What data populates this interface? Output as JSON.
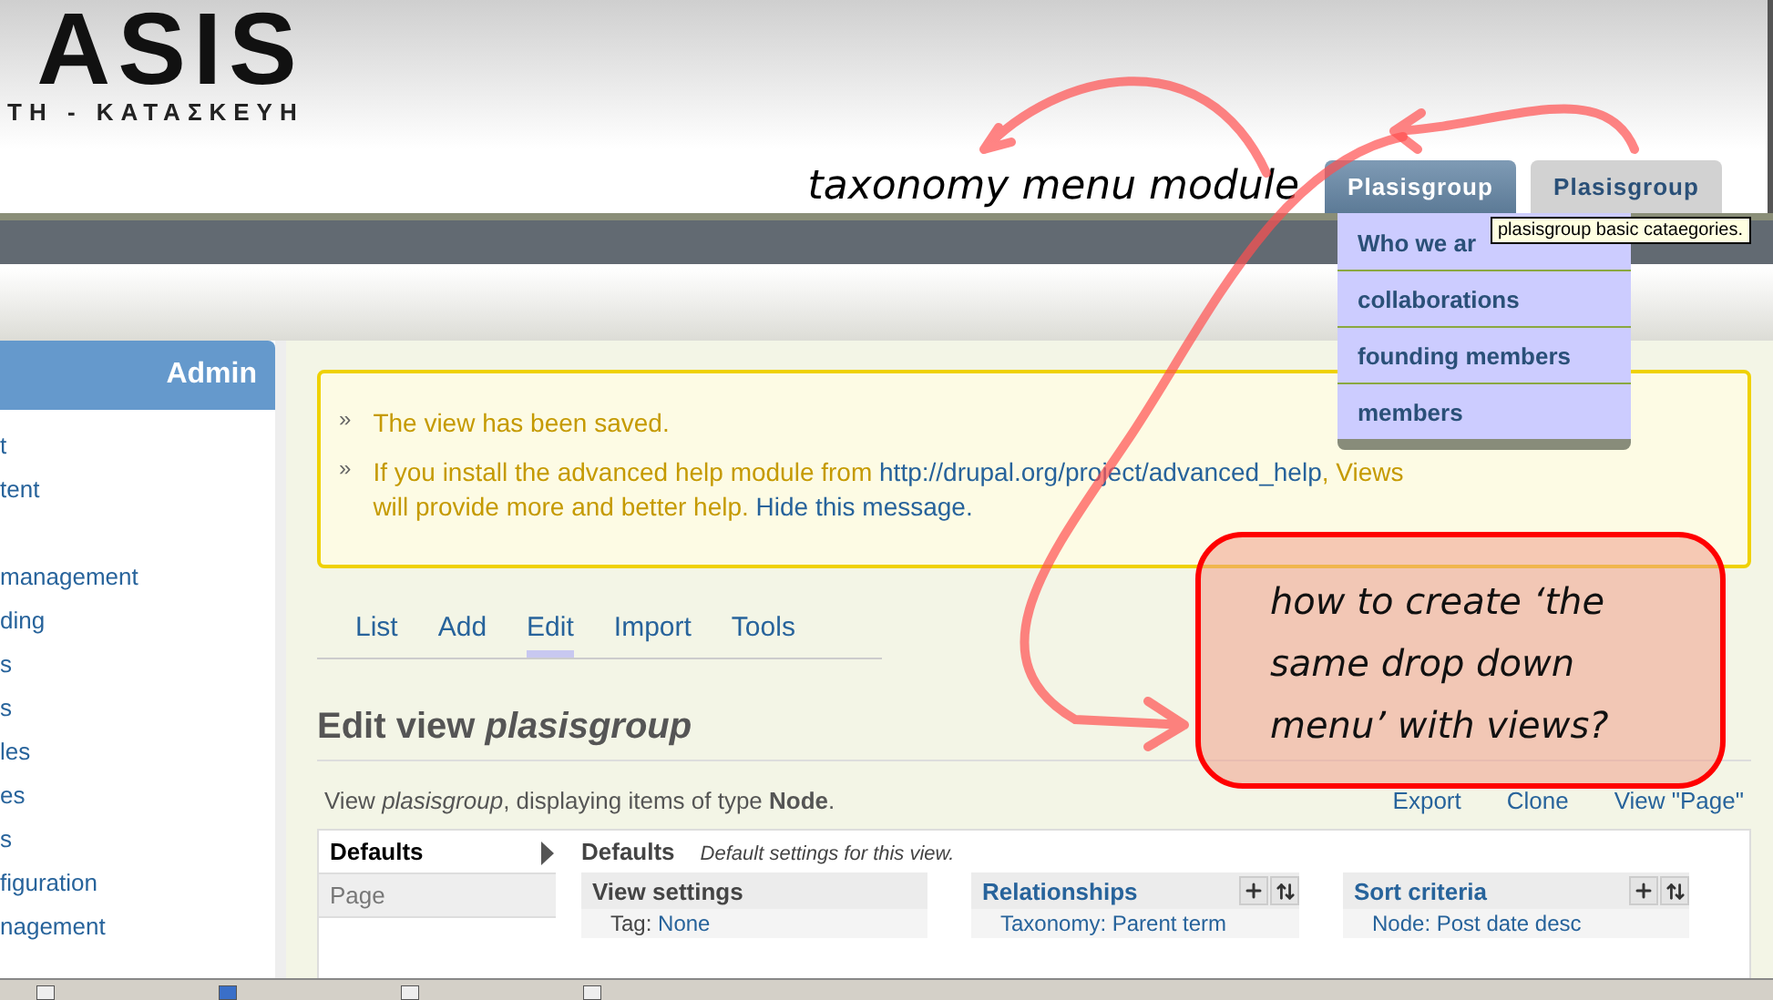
{
  "header": {
    "logo_text": "ASIS",
    "logo_subtitle": "ΤΗ - ΚΑΤΑΣΚΕΥΗ",
    "tabs": [
      {
        "label": "Plasisgroup",
        "selected": true
      },
      {
        "label": "Plasisgroup",
        "selected": false
      }
    ]
  },
  "dropdown": {
    "items": [
      "Who we ar",
      "collaborations",
      "founding members",
      "members"
    ]
  },
  "tooltip": "plasisgroup basic cataegories.",
  "sidebar": {
    "title": "Admin",
    "groups": [
      [
        "t",
        "tent"
      ],
      [
        "management",
        "ding",
        "s",
        "s",
        "les",
        "es",
        "s",
        "figuration",
        "nagement"
      ]
    ]
  },
  "messages": [
    {
      "bullet": "»",
      "parts": [
        {
          "kind": "text",
          "text": "The view has been saved."
        }
      ]
    },
    {
      "bullet": "»",
      "parts": [
        {
          "kind": "text",
          "text": "If you install the advanced help module from "
        },
        {
          "kind": "link",
          "text": "http://drupal.org/project/advanced_help"
        },
        {
          "kind": "text",
          "text": ", Views will provide more and better help. "
        },
        {
          "kind": "link",
          "text": "Hide this message."
        }
      ]
    }
  ],
  "tabs": [
    {
      "label": "List",
      "selected": false
    },
    {
      "label": "Add",
      "selected": false
    },
    {
      "label": "Edit",
      "selected": true
    },
    {
      "label": "Import",
      "selected": false
    },
    {
      "label": "Tools",
      "selected": false
    }
  ],
  "title": "Edit view *plasisgroup*",
  "summary": "View *plasisgroup*, displaying items of type **Node**.",
  "actions": [
    "Export",
    "Clone",
    "View \"Page\""
  ],
  "displays": [
    {
      "label": "Defaults",
      "selected": true
    },
    {
      "label": "Page",
      "selected": false
    }
  ],
  "display_heading": "Defaults",
  "display_description": "Default settings for this view.",
  "sections": [
    {
      "title": "View settings",
      "kind": "plain",
      "items": [
        {
          "label": "Tag:",
          "link": "None"
        }
      ]
    },
    {
      "title": "Relationships",
      "kind": "editable",
      "items": [
        {
          "link": "Taxonomy: Parent term"
        }
      ]
    },
    {
      "title": "Sort criteria",
      "kind": "editable",
      "items": [
        {
          "link": "Node: Post date desc"
        }
      ]
    }
  ],
  "annotations": {
    "note": "taxonomy menu module",
    "callout": "how to create ‘the same drop down menu’ with views?"
  }
}
